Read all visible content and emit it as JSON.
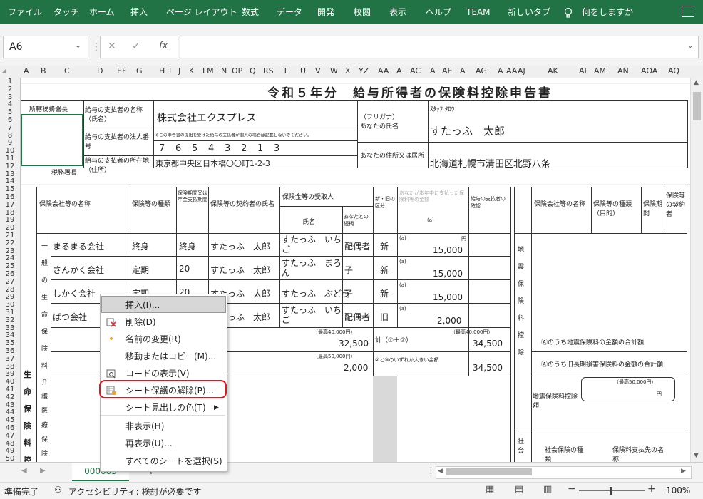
{
  "ribbon": {
    "tabs": [
      "ファイル",
      "タッチ",
      "ホーム",
      "挿入",
      "ページ レイアウト",
      "数式",
      "データ",
      "開発",
      "校閲",
      "表示",
      "ヘルプ",
      "TEAM",
      "新しいタブ"
    ],
    "search": "何をしますか"
  },
  "namebox": {
    "value": "A6"
  },
  "formula_bar": {
    "cancel": "✕",
    "enter": "✓",
    "fx": "fx",
    "value": ""
  },
  "columns": [
    "A",
    "B",
    "C",
    "D",
    "EF",
    "G",
    "H",
    "I",
    "J",
    "K",
    "LM",
    "N",
    "OP",
    "Q",
    "RS",
    "T",
    "U",
    "V",
    "W",
    "X",
    "YZ",
    "AA",
    "A",
    "AC",
    "A",
    "AE",
    "A",
    "AG",
    "A",
    "AA",
    "AJ",
    "AK",
    "AL",
    "AM",
    "AN",
    "AOA",
    "AQ"
  ],
  "rows": [
    "1",
    "2",
    "3",
    "4",
    "5",
    "6",
    "7",
    "8",
    "9",
    "10",
    "11",
    "12",
    "13",
    "14",
    "15",
    "16",
    "17",
    "18",
    "19",
    "20",
    "21",
    "22",
    "23",
    "24",
    "25",
    "26",
    "27",
    "28",
    "29",
    "30",
    "31",
    "32",
    "33",
    "34",
    "35",
    "36",
    "37",
    "38",
    "39",
    "40",
    "41",
    "42",
    "43",
    "44",
    "45",
    "46",
    "47",
    "48",
    "49",
    "50"
  ],
  "form": {
    "title": "令和５年分　給与所得者の保険料控除申告書",
    "tax_office_label": "所轄税務署長",
    "tax_office_suffix": "税務署長",
    "payer_name_label": "給与の支払者の名称（氏名）",
    "payer_name": "株式会社エクスプレス",
    "payer_number_label": "給与の支払者の法人番号",
    "payer_number_note": "※この申告書の提出を受けた給与の支払者が個人の場合は記載しないでください。",
    "payer_number_digits": [
      "7",
      "6",
      "5",
      "4",
      "3",
      "2",
      "1",
      "3"
    ],
    "payer_address_label": "給与の支払者の所在地（住所）",
    "payer_address": "東京都中央区日本橋〇〇町1-2-3",
    "furigana_label": "（フリガナ）",
    "furigana": "ｽﾀｯﾌ ﾀﾛｳ",
    "name_label": "あなたの氏名",
    "name": "すたっふ　太郎",
    "address_label": "あなたの住所又は居所",
    "address": "北海道札幌市清田区北野八条"
  },
  "insurance_table": {
    "headers": {
      "company": "保険会社等の名称",
      "type": "保険等の種類",
      "period": "保険期間又は年金支払期間",
      "contractor": "保険等の契約者の氏名",
      "recipient": "保険金等の受取人",
      "recipient_name": "氏名",
      "relation": "あなたとの続柄",
      "new_old": "新・旧の区分",
      "amount": "あなたが本年中に支払った保険料等の金額",
      "amount_letter": "(a)",
      "confirm": "給与の支払者の確認"
    },
    "side_label_general": "一般の生命保険料",
    "side_label_life": "生命保険料控除",
    "side_label_care": "介護医療保険料",
    "rows": [
      {
        "company": "まるまる会社",
        "type": "終身",
        "period": "終身",
        "contractor": "すたっふ　太郎",
        "recipient": "すたっふ　いちご",
        "relation": "配偶者",
        "kubun": "新",
        "amount": "15,000"
      },
      {
        "company": "さんかく会社",
        "type": "定期",
        "period": "20",
        "contractor": "すたっふ　太郎",
        "recipient": "すたっふ　まろん",
        "relation": "子",
        "kubun": "新",
        "amount": "15,000"
      },
      {
        "company": "しかく会社",
        "type": "定期",
        "period": "20",
        "contractor": "すたっふ　太郎",
        "recipient": "すたっふ　ぶどう",
        "relation": "子",
        "kubun": "新",
        "amount": "15,000"
      },
      {
        "company": "ばつ会社",
        "type": "",
        "period": "",
        "contractor": "すたっふ　太郎",
        "recipient": "すたっふ　いちご",
        "relation": "配偶者",
        "kubun": "旧",
        "amount": "2,000"
      }
    ],
    "totals": {
      "new_total": "32,500",
      "old_total": "2,000",
      "calc_new": "34,500",
      "calc_max": "34,500",
      "cap_label": "（最高40,000円）",
      "cap_label_old": "（最高50,000円）",
      "sum_label": "計（①＋②）",
      "max_label": "②と③のいずれか大きい金額"
    },
    "yen": "円"
  },
  "earthquake": {
    "side_label": "地震保険料控除",
    "side_label_social": "社会",
    "headers": [
      "保険会社等の名称",
      "保険等の種類（目的）",
      "保険期間",
      "保険等の契約者"
    ],
    "line1": "Ⓐのうち地震保険料の金額の合計額",
    "line2": "Ⓐのうち旧長期損害保険料の金額の合計額",
    "deduction_label": "地震保険料控除額",
    "cap": "（最高50,000円）",
    "social_headers": [
      "社会保険の種類",
      "保険料支払先の名称"
    ]
  },
  "context_menu": {
    "items": [
      {
        "label": "挿入(I)...",
        "icon": "insert-icon",
        "highlighted": true
      },
      {
        "label": "削除(D)",
        "icon": "delete-sheet-icon"
      },
      {
        "label": "名前の変更(R)",
        "icon": "rename-icon"
      },
      {
        "label": "移動またはコピー(M)...",
        "icon": ""
      },
      {
        "label": "コードの表示(V)",
        "icon": "view-code-icon"
      },
      {
        "label": "シート保護の解除(P)...",
        "icon": "unprotect-sheet-icon",
        "circled": true
      },
      {
        "label": "シート見出しの色(T)",
        "icon": "",
        "submenu": true
      },
      {
        "label": "非表示(H)",
        "icon": ""
      },
      {
        "label": "再表示(U)...",
        "icon": ""
      },
      {
        "label": "すべてのシートを選択(S)",
        "icon": ""
      }
    ]
  },
  "sheet_tabs": {
    "active": "000003",
    "add": "+"
  },
  "status_bar": {
    "ready": "準備完了",
    "accessibility": "アクセシビリティ: 検討が必要です",
    "zoom": "100%"
  },
  "colors": {
    "ribbon": "#217346",
    "highlight_circle": "#e0161e",
    "menu_hover": "#d7d7d7"
  }
}
